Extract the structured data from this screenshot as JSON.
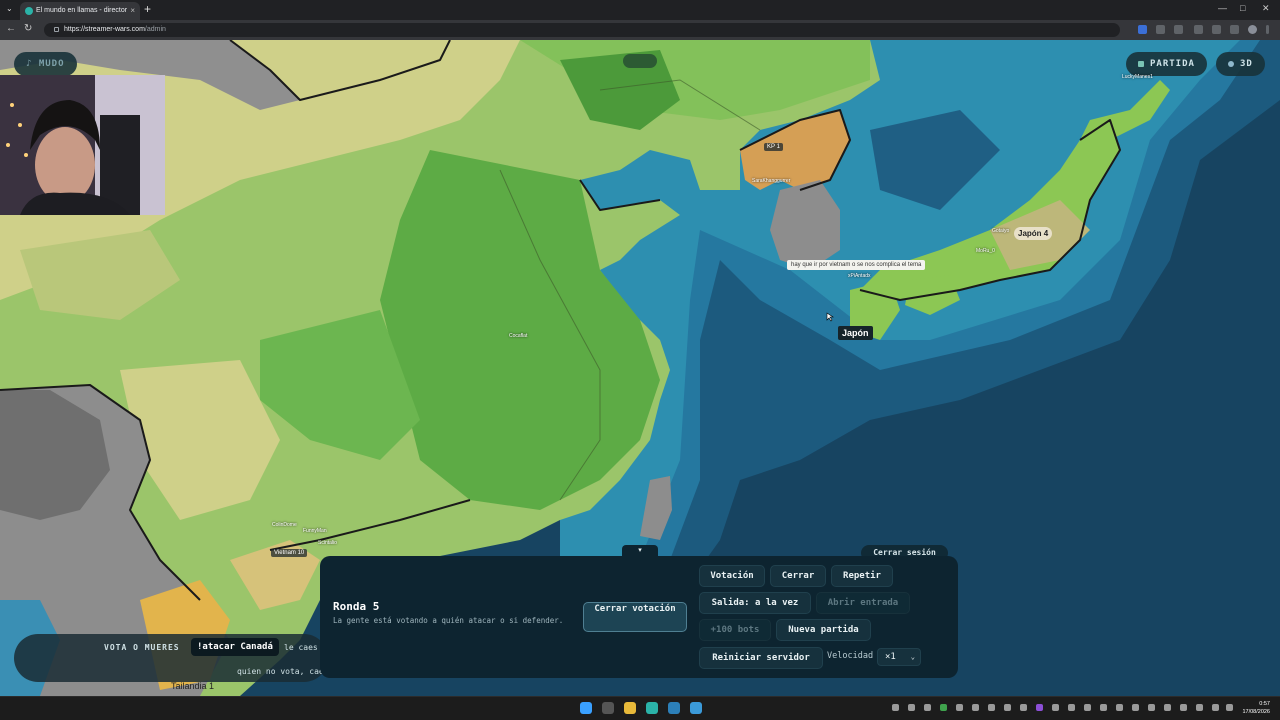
{
  "browser": {
    "tab_title": "El mundo en llamas - director",
    "tab_close": "×",
    "new_tab": "+",
    "tab_menu": "⌄",
    "url_host": "https://streamer-wars.com",
    "url_path": "/admin",
    "minimize": "—",
    "maximize": "□",
    "close": "✕",
    "back": "←",
    "forward": "→",
    "reload": "↻"
  },
  "top_chips": {
    "mute_label": "MUDO",
    "match_label": "PARTIDA",
    "view_3d_label": "3D"
  },
  "map": {
    "labels": {
      "korea": "KP 1",
      "japan_count": "Japón 4",
      "japan_name": "Japón",
      "vietnam": "Vietnam 10",
      "thailand": "Tailandia 1",
      "chat_bubble": "hay que ir por vietnam o se nos complica el tema"
    },
    "cities": [
      "SaraKhanggurrer",
      "LuckyManes1",
      "Cocaflat",
      "ColinDome",
      "Gotaiyo",
      "MoRu_0",
      "xPiAntadx",
      "FunnyMan",
      "Scintalio"
    ]
  },
  "panel": {
    "toggle": "▾",
    "logout": "Cerrar sesión",
    "round_title": "Ronda 5",
    "round_description": "La gente está votando a quién atacar o si defender.",
    "close_vote": "Cerrar votación",
    "buttons": {
      "vote": "Votación",
      "close": "Cerrar",
      "repeat": "Repetir",
      "exit_mode": "Salida: a la vez",
      "open_entry": "Abrir entrada",
      "bots": "+100 bots",
      "new_match": "Nueva partida",
      "restart_server": "Reiniciar servidor"
    },
    "speed_label": "Velocidad",
    "speed_value": "×1"
  },
  "vote_bar": {
    "label": "VOTA O MUERES",
    "command": "!atacar Canadá",
    "tail": "le caes",
    "subline": "quien no vota, cae"
  },
  "taskbar": {
    "time": "0:57",
    "date": "17/08/2026"
  },
  "colors": {
    "ocean": "#174461",
    "panel": "#0d2430",
    "land_green": "#5dab45",
    "land_yellow": "#cfd089",
    "accent": "#79c3b4"
  }
}
